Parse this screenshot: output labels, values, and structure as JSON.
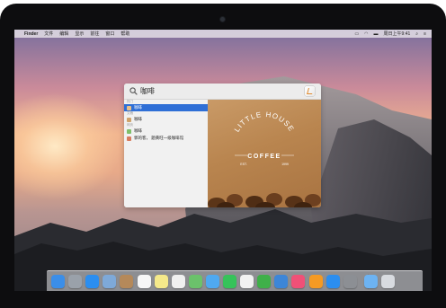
{
  "menubar": {
    "app_name": "Finder",
    "items": [
      "文件",
      "编辑",
      "显示",
      "前往",
      "窗口",
      "帮助"
    ],
    "clock": "周日上午9:41"
  },
  "spotlight": {
    "query": "咖啡",
    "sections": {
      "top_hit": "热门",
      "files": "文稿",
      "web": "网页"
    },
    "results": [
      {
        "label": "咖啡",
        "selected": true
      },
      {
        "label": "咖啡",
        "selected": false
      },
      {
        "label": "咖啡",
        "selected": false
      },
      {
        "label": "郭的客，  题黄旺一级咖啡馆",
        "selected": false
      }
    ],
    "preview": {
      "logo_line1": "LITTLE HOUSE",
      "logo_line2": "COFFEE",
      "logo_left": "EST.",
      "logo_right": "1999"
    }
  },
  "dock": {
    "apps": [
      {
        "name": "finder-icon",
        "color": "#3b8ee8"
      },
      {
        "name": "launchpad-icon",
        "color": "#9aa1aa"
      },
      {
        "name": "safari-icon",
        "color": "#2b8ef0"
      },
      {
        "name": "mail-icon",
        "color": "#7ea9d8"
      },
      {
        "name": "contacts-icon",
        "color": "#b5895a"
      },
      {
        "name": "calendar-icon",
        "color": "#f7f7f7"
      },
      {
        "name": "notes-icon",
        "color": "#f5e98a"
      },
      {
        "name": "reminders-icon",
        "color": "#f0f0f0"
      },
      {
        "name": "maps-icon",
        "color": "#6bc26b"
      },
      {
        "name": "messages-icon",
        "color": "#4fa9f0"
      },
      {
        "name": "facetime-icon",
        "color": "#36c35a"
      },
      {
        "name": "photos-icon",
        "color": "#f2f2f2"
      },
      {
        "name": "numbers-icon",
        "color": "#3fb049"
      },
      {
        "name": "keynote-icon",
        "color": "#3d86d8"
      },
      {
        "name": "itunes-icon",
        "color": "#f05077"
      },
      {
        "name": "ibooks-icon",
        "color": "#f59a23"
      },
      {
        "name": "appstore-icon",
        "color": "#2b8ef0"
      },
      {
        "name": "system-preferences-icon",
        "color": "#8c8f94"
      },
      {
        "name": "downloads-folder-icon",
        "color": "#6db3f2"
      },
      {
        "name": "trash-icon",
        "color": "#d8dbe0"
      }
    ]
  }
}
